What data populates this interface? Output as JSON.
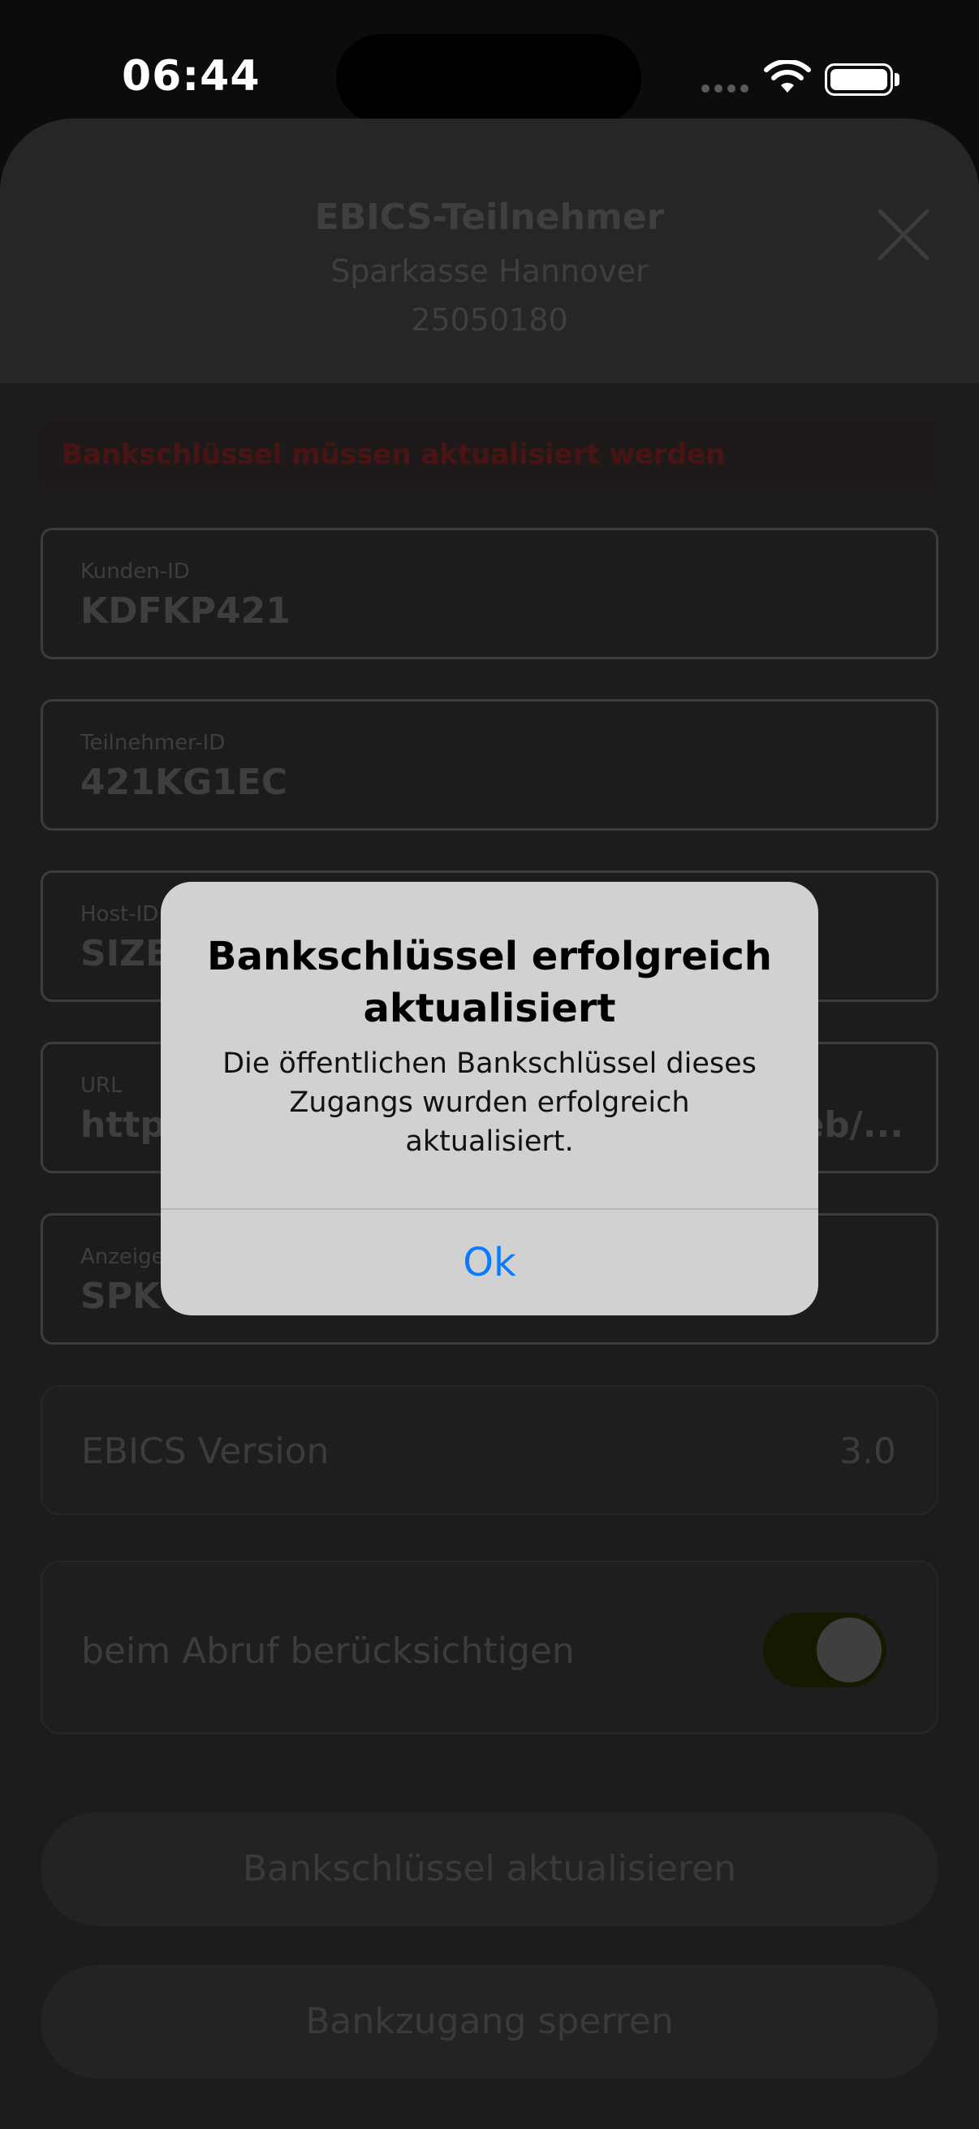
{
  "status_bar": {
    "time": "06:44"
  },
  "sheet": {
    "title": "EBICS-Teilnehmer",
    "bank_name": "Sparkasse Hannover",
    "bank_code": "25050180",
    "warning": "Bankschlüssel müssen aktualisiert werden"
  },
  "fields": [
    {
      "label": "Kunden-ID",
      "value": "KDFKP421"
    },
    {
      "label": "Teilnehmer-ID",
      "value": "421KG1EC"
    },
    {
      "label": "Host-ID",
      "value": "SIZB"
    },
    {
      "label": "URL",
      "value": "https",
      "value_tail": "eb/..."
    },
    {
      "label": "Anzeige",
      "value": "SPK I"
    }
  ],
  "ebics_version": {
    "label": "EBICS Version",
    "value": "3.0"
  },
  "include_toggle": {
    "label": "beim Abruf berücksichtigen",
    "on": true
  },
  "actions": {
    "update_keys": "Bankschlüssel aktualisieren",
    "lock_access": "Bankzugang sperren"
  },
  "alert": {
    "title": "Bankschlüssel erfolgreich aktualisiert",
    "message": "Die öffentlichen Bankschlüssel dieses Zugangs wurden erfolgreich aktualisiert.",
    "ok_label": "Ok",
    "ok_color": "#0a7aff"
  }
}
